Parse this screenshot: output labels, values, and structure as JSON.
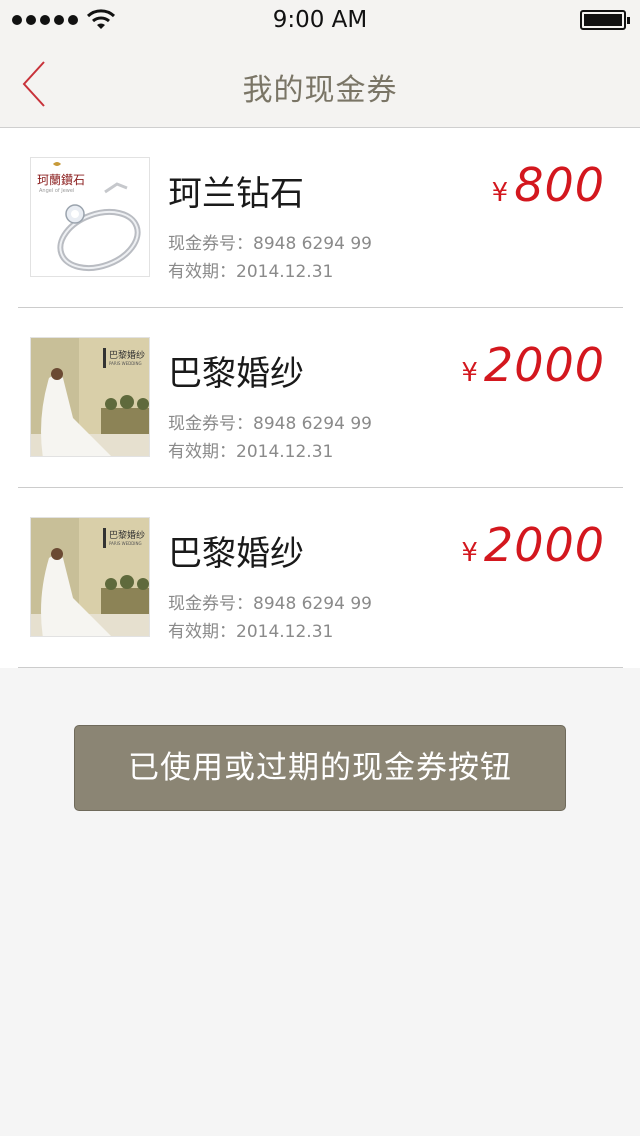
{
  "status_bar": {
    "time": "9:00 AM"
  },
  "nav": {
    "title": "我的现金券"
  },
  "vouchers": [
    {
      "name": "珂兰钻石",
      "code": "现金券号：8948 6294 99",
      "expire": "有效期：2014.12.31",
      "currency": "¥",
      "amount": "800",
      "thumb_logo": "珂蘭鑽石",
      "thumb_sub": "Angel of Jewel"
    },
    {
      "name": "巴黎婚纱",
      "code": "现金券号：8948 6294 99",
      "expire": "有效期：2014.12.31",
      "currency": "¥",
      "amount": "2000",
      "thumb_logo": "巴黎婚纱",
      "thumb_sub": "PARIS WEDDING"
    },
    {
      "name": "巴黎婚纱",
      "code": "现金券号：8948 6294 99",
      "expire": "有效期：2014.12.31",
      "currency": "¥",
      "amount": "2000",
      "thumb_logo": "巴黎婚纱",
      "thumb_sub": "PARIS WEDDING"
    }
  ],
  "history_button": {
    "label": "已使用或过期的现金券按钮"
  },
  "colors": {
    "accent": "#d3171e",
    "button_bg": "#8b8574",
    "title_color": "#7a7566",
    "back_arrow": "#c8323a"
  },
  "icons": {
    "back": "chevron-left-icon",
    "signal": "signal-icon",
    "wifi": "wifi-icon",
    "battery": "battery-icon"
  }
}
